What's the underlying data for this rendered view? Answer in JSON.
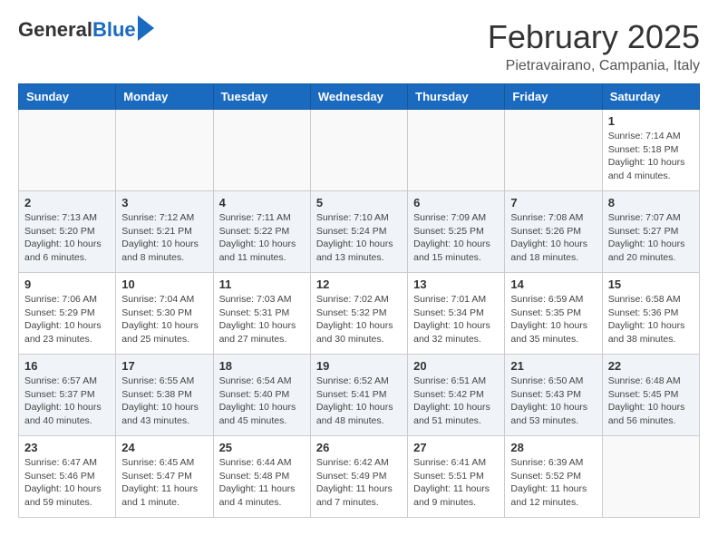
{
  "header": {
    "logo_general": "General",
    "logo_blue": "Blue",
    "month_title": "February 2025",
    "location": "Pietravairano, Campania, Italy"
  },
  "weekdays": [
    "Sunday",
    "Monday",
    "Tuesday",
    "Wednesday",
    "Thursday",
    "Friday",
    "Saturday"
  ],
  "weeks": [
    [
      {
        "day": "",
        "info": ""
      },
      {
        "day": "",
        "info": ""
      },
      {
        "day": "",
        "info": ""
      },
      {
        "day": "",
        "info": ""
      },
      {
        "day": "",
        "info": ""
      },
      {
        "day": "",
        "info": ""
      },
      {
        "day": "1",
        "info": "Sunrise: 7:14 AM\nSunset: 5:18 PM\nDaylight: 10 hours and 4 minutes."
      }
    ],
    [
      {
        "day": "2",
        "info": "Sunrise: 7:13 AM\nSunset: 5:20 PM\nDaylight: 10 hours and 6 minutes."
      },
      {
        "day": "3",
        "info": "Sunrise: 7:12 AM\nSunset: 5:21 PM\nDaylight: 10 hours and 8 minutes."
      },
      {
        "day": "4",
        "info": "Sunrise: 7:11 AM\nSunset: 5:22 PM\nDaylight: 10 hours and 11 minutes."
      },
      {
        "day": "5",
        "info": "Sunrise: 7:10 AM\nSunset: 5:24 PM\nDaylight: 10 hours and 13 minutes."
      },
      {
        "day": "6",
        "info": "Sunrise: 7:09 AM\nSunset: 5:25 PM\nDaylight: 10 hours and 15 minutes."
      },
      {
        "day": "7",
        "info": "Sunrise: 7:08 AM\nSunset: 5:26 PM\nDaylight: 10 hours and 18 minutes."
      },
      {
        "day": "8",
        "info": "Sunrise: 7:07 AM\nSunset: 5:27 PM\nDaylight: 10 hours and 20 minutes."
      }
    ],
    [
      {
        "day": "9",
        "info": "Sunrise: 7:06 AM\nSunset: 5:29 PM\nDaylight: 10 hours and 23 minutes."
      },
      {
        "day": "10",
        "info": "Sunrise: 7:04 AM\nSunset: 5:30 PM\nDaylight: 10 hours and 25 minutes."
      },
      {
        "day": "11",
        "info": "Sunrise: 7:03 AM\nSunset: 5:31 PM\nDaylight: 10 hours and 27 minutes."
      },
      {
        "day": "12",
        "info": "Sunrise: 7:02 AM\nSunset: 5:32 PM\nDaylight: 10 hours and 30 minutes."
      },
      {
        "day": "13",
        "info": "Sunrise: 7:01 AM\nSunset: 5:34 PM\nDaylight: 10 hours and 32 minutes."
      },
      {
        "day": "14",
        "info": "Sunrise: 6:59 AM\nSunset: 5:35 PM\nDaylight: 10 hours and 35 minutes."
      },
      {
        "day": "15",
        "info": "Sunrise: 6:58 AM\nSunset: 5:36 PM\nDaylight: 10 hours and 38 minutes."
      }
    ],
    [
      {
        "day": "16",
        "info": "Sunrise: 6:57 AM\nSunset: 5:37 PM\nDaylight: 10 hours and 40 minutes."
      },
      {
        "day": "17",
        "info": "Sunrise: 6:55 AM\nSunset: 5:38 PM\nDaylight: 10 hours and 43 minutes."
      },
      {
        "day": "18",
        "info": "Sunrise: 6:54 AM\nSunset: 5:40 PM\nDaylight: 10 hours and 45 minutes."
      },
      {
        "day": "19",
        "info": "Sunrise: 6:52 AM\nSunset: 5:41 PM\nDaylight: 10 hours and 48 minutes."
      },
      {
        "day": "20",
        "info": "Sunrise: 6:51 AM\nSunset: 5:42 PM\nDaylight: 10 hours and 51 minutes."
      },
      {
        "day": "21",
        "info": "Sunrise: 6:50 AM\nSunset: 5:43 PM\nDaylight: 10 hours and 53 minutes."
      },
      {
        "day": "22",
        "info": "Sunrise: 6:48 AM\nSunset: 5:45 PM\nDaylight: 10 hours and 56 minutes."
      }
    ],
    [
      {
        "day": "23",
        "info": "Sunrise: 6:47 AM\nSunset: 5:46 PM\nDaylight: 10 hours and 59 minutes."
      },
      {
        "day": "24",
        "info": "Sunrise: 6:45 AM\nSunset: 5:47 PM\nDaylight: 11 hours and 1 minute."
      },
      {
        "day": "25",
        "info": "Sunrise: 6:44 AM\nSunset: 5:48 PM\nDaylight: 11 hours and 4 minutes."
      },
      {
        "day": "26",
        "info": "Sunrise: 6:42 AM\nSunset: 5:49 PM\nDaylight: 11 hours and 7 minutes."
      },
      {
        "day": "27",
        "info": "Sunrise: 6:41 AM\nSunset: 5:51 PM\nDaylight: 11 hours and 9 minutes."
      },
      {
        "day": "28",
        "info": "Sunrise: 6:39 AM\nSunset: 5:52 PM\nDaylight: 11 hours and 12 minutes."
      },
      {
        "day": "",
        "info": ""
      }
    ]
  ]
}
